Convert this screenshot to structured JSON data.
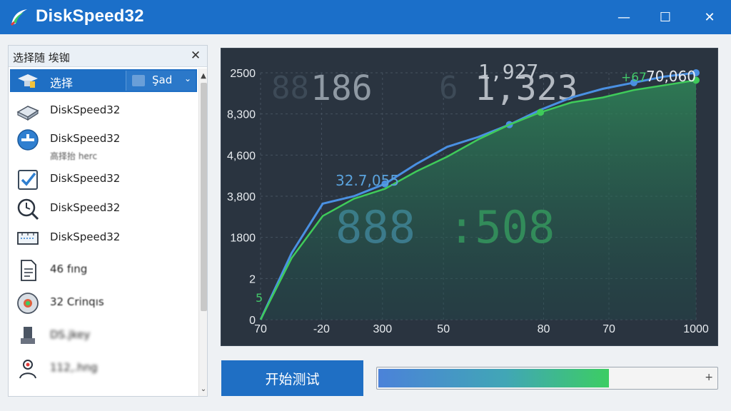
{
  "window": {
    "title": "DiskSpeed32",
    "controls": {
      "minimize": "—",
      "maximize": "☐",
      "close": "✕"
    }
  },
  "panel": {
    "title": "选择随 埃铷",
    "close_glyph": "✕",
    "selected_item": {
      "icon": "graduation-cap-icon",
      "label": "选择",
      "dropdown_value": "Şad",
      "dropdown_arrow": "⌄"
    },
    "items": [
      {
        "icon": "drive-icon",
        "label": "DiskSpeed32",
        "sub": ""
      },
      {
        "icon": "disk-circle-icon",
        "label": "DiskSpeed32",
        "sub": "高择抬 herc"
      },
      {
        "icon": "checkbox-icon",
        "label": "DiskSpeed32",
        "sub": ""
      },
      {
        "icon": "clock-search-icon",
        "label": "DiskSpeed32",
        "sub": ""
      },
      {
        "icon": "ruler-icon",
        "label": "DiskSpeed32",
        "sub": ""
      },
      {
        "icon": "document-icon",
        "label": "46 fıng",
        "sub": ""
      },
      {
        "icon": "gauge-icon",
        "label": "32 Crinqıs",
        "sub": ""
      },
      {
        "icon": "device-icon",
        "label": "DS.jkey",
        "sub": ""
      },
      {
        "icon": "user-icon",
        "label": "112,.hng",
        "sub": ""
      }
    ],
    "scroll_up": "▲",
    "scroll_down": "⌄"
  },
  "chart_data": {
    "type": "line",
    "y_tick_labels": [
      "2500",
      "8,300",
      "4,600",
      "3,800",
      "1800",
      "2",
      "0"
    ],
    "x_tick_labels": [
      "70",
      "-20",
      "300",
      "50",
      "80",
      "70",
      "1000"
    ],
    "big_readouts": [
      "186",
      "1,323",
      "888",
      ":508"
    ],
    "faded_readouts": [
      "88",
      "6"
    ],
    "readout_header": "1,927",
    "annotations": [
      "32.7,055",
      "+67",
      "70,060",
      "5"
    ],
    "grid": true,
    "series": [
      {
        "color": "#4a90e2",
        "values": [
          0,
          0.27,
          0.47,
          0.5,
          0.55,
          0.63,
          0.7,
          0.74,
          0.79,
          0.85,
          0.9,
          0.935,
          0.96,
          0.985,
          1.0
        ]
      },
      {
        "color": "#3fcb5a",
        "values": [
          0,
          0.25,
          0.42,
          0.49,
          0.53,
          0.6,
          0.66,
          0.73,
          0.79,
          0.84,
          0.88,
          0.9,
          0.93,
          0.95,
          0.97
        ]
      }
    ]
  },
  "controls": {
    "start_label": "开始测试",
    "progress_fraction": 0.68,
    "progress_plus": "+"
  }
}
